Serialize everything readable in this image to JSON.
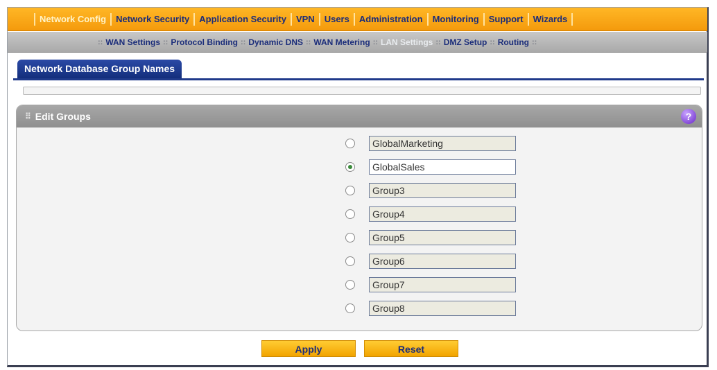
{
  "topnav": {
    "items": [
      {
        "label": "Network Config",
        "active": true
      },
      {
        "label": "Network Security"
      },
      {
        "label": "Application Security"
      },
      {
        "label": "VPN"
      },
      {
        "label": "Users"
      },
      {
        "label": "Administration"
      },
      {
        "label": "Monitoring"
      },
      {
        "label": "Support"
      },
      {
        "label": "Wizards"
      }
    ]
  },
  "subnav": {
    "separator": "::",
    "items": [
      {
        "label": "WAN Settings"
      },
      {
        "label": "Protocol Binding"
      },
      {
        "label": "Dynamic DNS"
      },
      {
        "label": "WAN Metering"
      },
      {
        "label": "LAN Settings",
        "active": true
      },
      {
        "label": "DMZ Setup"
      },
      {
        "label": "Routing"
      }
    ]
  },
  "tab": {
    "label": "Network Database Group Names"
  },
  "panel": {
    "title": "Edit Groups",
    "help": "?",
    "groups": [
      {
        "value": "GlobalMarketing",
        "checked": false
      },
      {
        "value": "GlobalSales",
        "checked": true
      },
      {
        "value": "Group3",
        "checked": false
      },
      {
        "value": "Group4",
        "checked": false
      },
      {
        "value": "Group5",
        "checked": false
      },
      {
        "value": "Group6",
        "checked": false
      },
      {
        "value": "Group7",
        "checked": false
      },
      {
        "value": "Group8",
        "checked": false
      }
    ]
  },
  "buttons": {
    "apply": "Apply",
    "reset": "Reset"
  },
  "colors": {
    "accent_orange": "#f49a0c",
    "nav_text": "#1b2d7a",
    "tab_blue": "#1f3a8a"
  }
}
